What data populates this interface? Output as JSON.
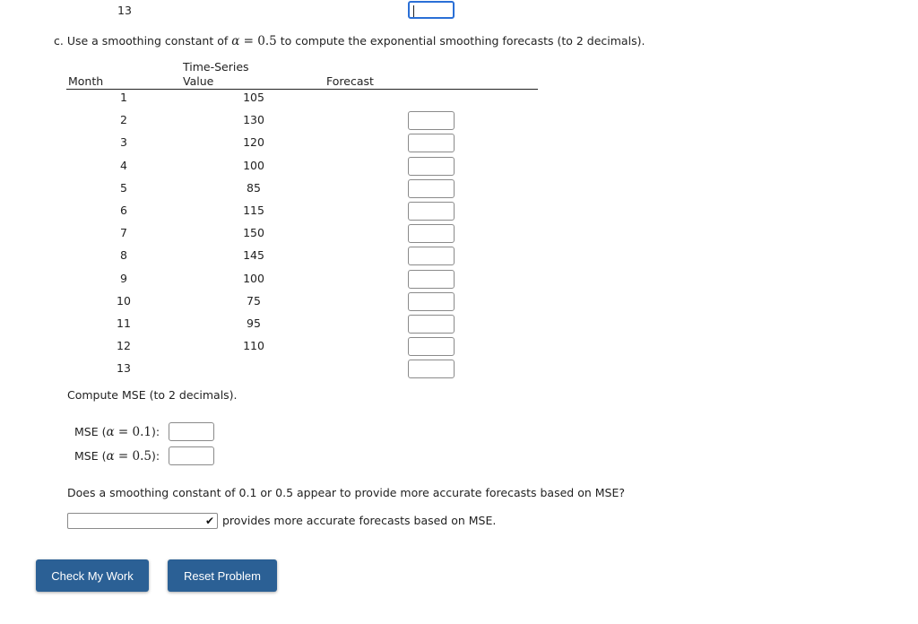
{
  "prev_row": {
    "month": "13"
  },
  "part_c": {
    "prefix": "c. Use a smoothing constant of ",
    "alpha_symbol": "α",
    "equals": " = ",
    "alpha_value": "0.5",
    "suffix": " to compute the exponential smoothing forecasts (to 2 decimals)."
  },
  "table": {
    "headers": {
      "month": "Month",
      "value_line1": "Time-Series",
      "value_line2": "Value",
      "forecast": "Forecast"
    },
    "rows": [
      {
        "month": "1",
        "value": "105",
        "has_input": false,
        "forecast": ""
      },
      {
        "month": "2",
        "value": "130",
        "has_input": true,
        "forecast": ""
      },
      {
        "month": "3",
        "value": "120",
        "has_input": true,
        "forecast": ""
      },
      {
        "month": "4",
        "value": "100",
        "has_input": true,
        "forecast": ""
      },
      {
        "month": "5",
        "value": "85",
        "has_input": true,
        "forecast": ""
      },
      {
        "month": "6",
        "value": "115",
        "has_input": true,
        "forecast": ""
      },
      {
        "month": "7",
        "value": "150",
        "has_input": true,
        "forecast": ""
      },
      {
        "month": "8",
        "value": "145",
        "has_input": true,
        "forecast": ""
      },
      {
        "month": "9",
        "value": "100",
        "has_input": true,
        "forecast": ""
      },
      {
        "month": "10",
        "value": "75",
        "has_input": true,
        "forecast": ""
      },
      {
        "month": "11",
        "value": "95",
        "has_input": true,
        "forecast": ""
      },
      {
        "month": "12",
        "value": "110",
        "has_input": true,
        "forecast": ""
      },
      {
        "month": "13",
        "value": "",
        "has_input": true,
        "forecast": ""
      }
    ]
  },
  "mse": {
    "instruction": "Compute MSE (to 2 decimals).",
    "label_prefix": "MSE (",
    "alpha_symbol": "α",
    "equals": " = ",
    "alpha1": "0.1",
    "alpha2": "0.5",
    "label_suffix": "):",
    "value1": "",
    "value2": ""
  },
  "question": {
    "text": "Does a smoothing constant of 0.1 or 0.5 appear to provide more accurate forecasts based on MSE?",
    "select_value": "",
    "after_select": "provides more accurate forecasts based on MSE."
  },
  "buttons": {
    "check": "Check My Work",
    "reset": "Reset Problem"
  },
  "colors": {
    "button_bg": "#2b6095",
    "focus_border": "#2a6fd6"
  }
}
